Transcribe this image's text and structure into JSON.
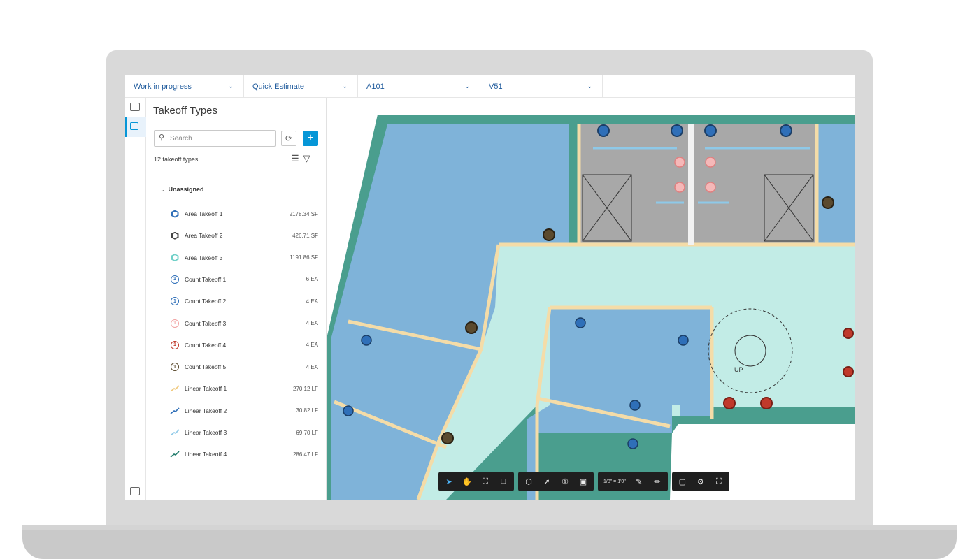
{
  "topbar": {
    "dropdowns": [
      {
        "label": "Work in progress"
      },
      {
        "label": "Quick Estimate"
      },
      {
        "label": "A101"
      },
      {
        "label": "V51"
      }
    ]
  },
  "panel": {
    "title": "Takeoff Types",
    "search_placeholder": "Search",
    "count_text": "12 takeoff types",
    "group_label": "Unassigned",
    "items": [
      {
        "name": "Area Takeoff 1",
        "value": "2178.34 SF",
        "kind": "area",
        "color": "#2f6fb8"
      },
      {
        "name": "Area Takeoff 2",
        "value": "426.71 SF",
        "kind": "area",
        "color": "#444444"
      },
      {
        "name": "Area Takeoff 3",
        "value": "1191.86 SF",
        "kind": "area",
        "color": "#6fd0c8"
      },
      {
        "name": "Count Takeoff 1",
        "value": "6 EA",
        "kind": "count",
        "color": "#2f6fb8"
      },
      {
        "name": "Count Takeoff 2",
        "value": "4 EA",
        "kind": "count",
        "color": "#2f6fb8"
      },
      {
        "name": "Count Takeoff 3",
        "value": "4 EA",
        "kind": "count",
        "color": "#f2a3a3"
      },
      {
        "name": "Count Takeoff 4",
        "value": "4 EA",
        "kind": "count",
        "color": "#c0392b"
      },
      {
        "name": "Count Takeoff 5",
        "value": "4 EA",
        "kind": "count",
        "color": "#5b4a2e"
      },
      {
        "name": "Linear Takeoff 1",
        "value": "270.12 LF",
        "kind": "linear",
        "color": "#f0c87a"
      },
      {
        "name": "Linear Takeoff 2",
        "value": "30.82 LF",
        "kind": "linear",
        "color": "#2f6fb8"
      },
      {
        "name": "Linear Takeoff 3",
        "value": "69.70 LF",
        "kind": "linear",
        "color": "#8ec9e8"
      },
      {
        "name": "Linear Takeoff 4",
        "value": "286.47 LF",
        "kind": "linear",
        "color": "#1e7a6a"
      }
    ]
  },
  "plan": {
    "stair_label": "UP",
    "colors": {
      "area_blue": "#7fb3d9",
      "area_teal": "#c2ece6",
      "wall_teal": "#4a9e8e",
      "wall_beige": "#f4dca8",
      "restroom_gray": "#a8a8a8"
    }
  },
  "toolbar": {
    "scale_label": "1/8\" = 1'0\""
  }
}
